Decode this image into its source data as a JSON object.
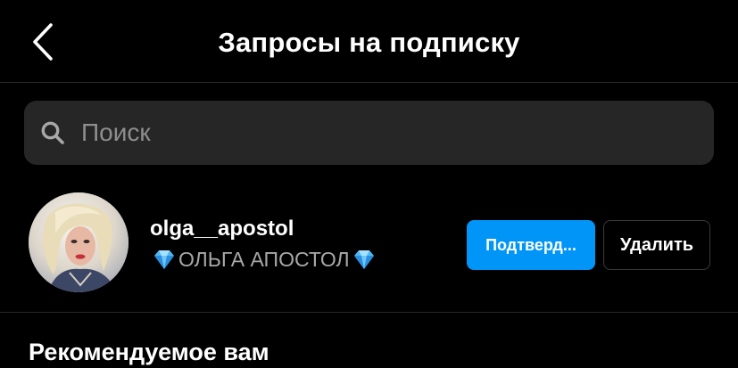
{
  "header": {
    "title": "Запросы на подписку",
    "back_icon": "chevron-left-icon"
  },
  "search": {
    "placeholder": "Поиск",
    "value": "",
    "icon": "search-icon"
  },
  "requests": [
    {
      "username": "olga__apostol",
      "full_name": "ОЛЬГА АПОСТОЛ",
      "name_decoration_icon": "diamond-emoji-icon",
      "confirm_label": "Подтверд...",
      "delete_label": "Удалить"
    }
  ],
  "recommended": {
    "title": "Рекомендуемое вам"
  },
  "colors": {
    "background": "#000000",
    "accent": "#0095f6",
    "search_bg": "#262626",
    "secondary_text": "#a8a8a8",
    "placeholder_text": "#8e8e8e",
    "divider": "#262626"
  }
}
